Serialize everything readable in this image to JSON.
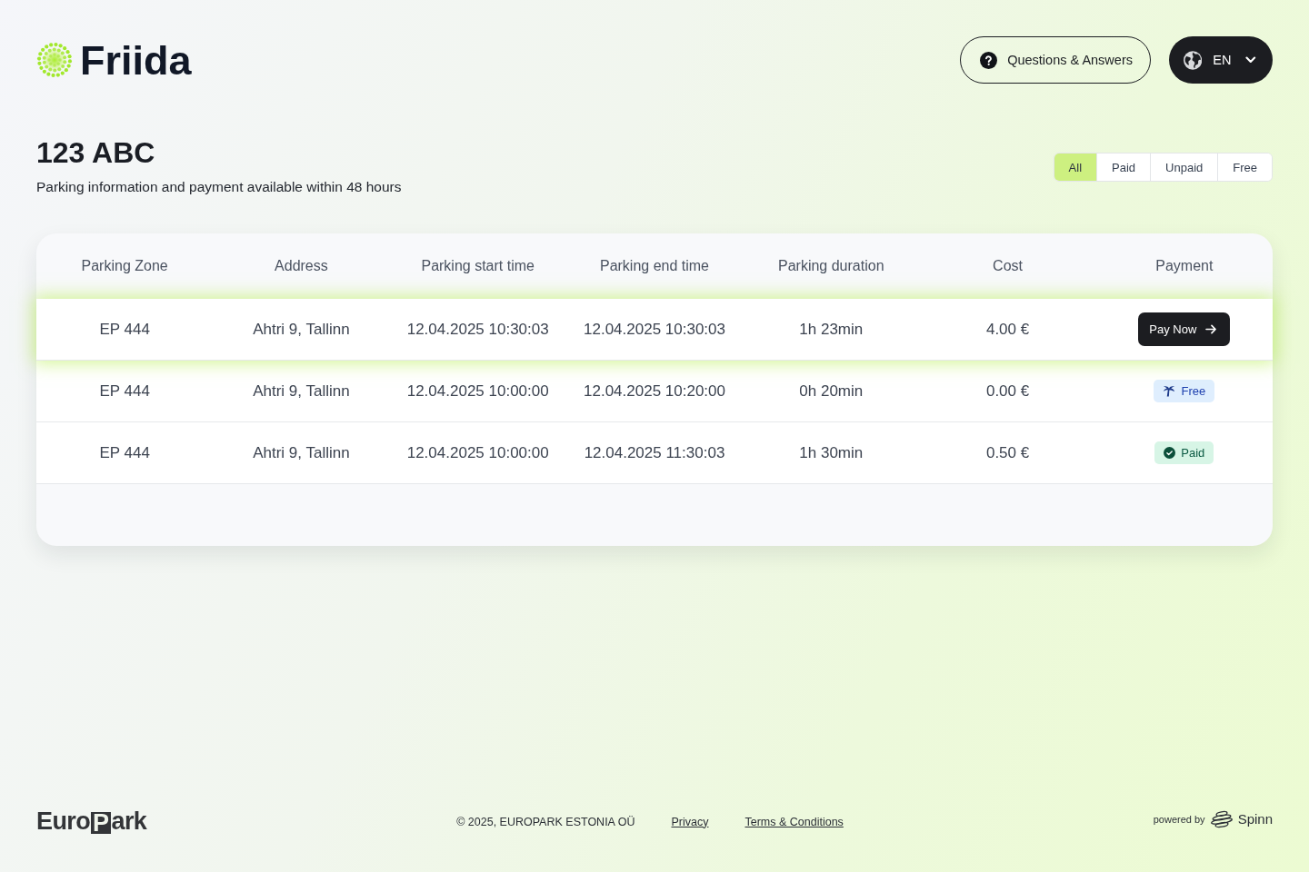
{
  "header": {
    "brand": "Friida",
    "help_button": "Questions & Answers",
    "language": "EN"
  },
  "vehicle": {
    "plate": "123 ABC",
    "note": "Parking information and payment available within 48 hours"
  },
  "filters": [
    {
      "label": "All",
      "selected": true
    },
    {
      "label": "Paid",
      "selected": false
    },
    {
      "label": "Unpaid",
      "selected": false
    },
    {
      "label": "Free",
      "selected": false
    }
  ],
  "table": {
    "columns": [
      "Parking Zone",
      "Address",
      "Parking start time",
      "Parking end time",
      "Parking duration",
      "Cost",
      "Payment"
    ],
    "rows": [
      {
        "highlighted": true,
        "cells": [
          "EP 444",
          "Ahtri 9, Tallinn",
          "12.04.2025 10:30:03",
          "12.04.2025 10:30:03",
          "1h 23min",
          "4.00 €"
        ],
        "payment": {
          "kind": "button",
          "label": "Pay Now"
        }
      },
      {
        "highlighted": false,
        "cells": [
          "EP 444",
          "Ahtri 9, Tallinn",
          "12.04.2025 10:00:00",
          "12.04.2025 10:20:00",
          "0h 20min",
          "0.00 €"
        ],
        "payment": {
          "kind": "free",
          "label": "Free"
        }
      },
      {
        "highlighted": false,
        "cells": [
          "EP 444",
          "Ahtri 9, Tallinn",
          "12.04.2025 10:00:00",
          "12.04.2025 11:30:03",
          "1h 30min",
          "0.50 €"
        ],
        "payment": {
          "kind": "paid",
          "label": "Paid"
        }
      }
    ]
  },
  "footer": {
    "logo": [
      {
        "text": "Euro",
        "boxed": false
      },
      {
        "text": "P",
        "boxed": true
      },
      {
        "text": "ark",
        "boxed": false
      }
    ],
    "copyright": "© 2025, EUROPARK ESTONIA OÜ",
    "links": [
      "Privacy",
      "Terms & Conditions"
    ],
    "powered_by": "powered by",
    "partner": "Spinn"
  }
}
